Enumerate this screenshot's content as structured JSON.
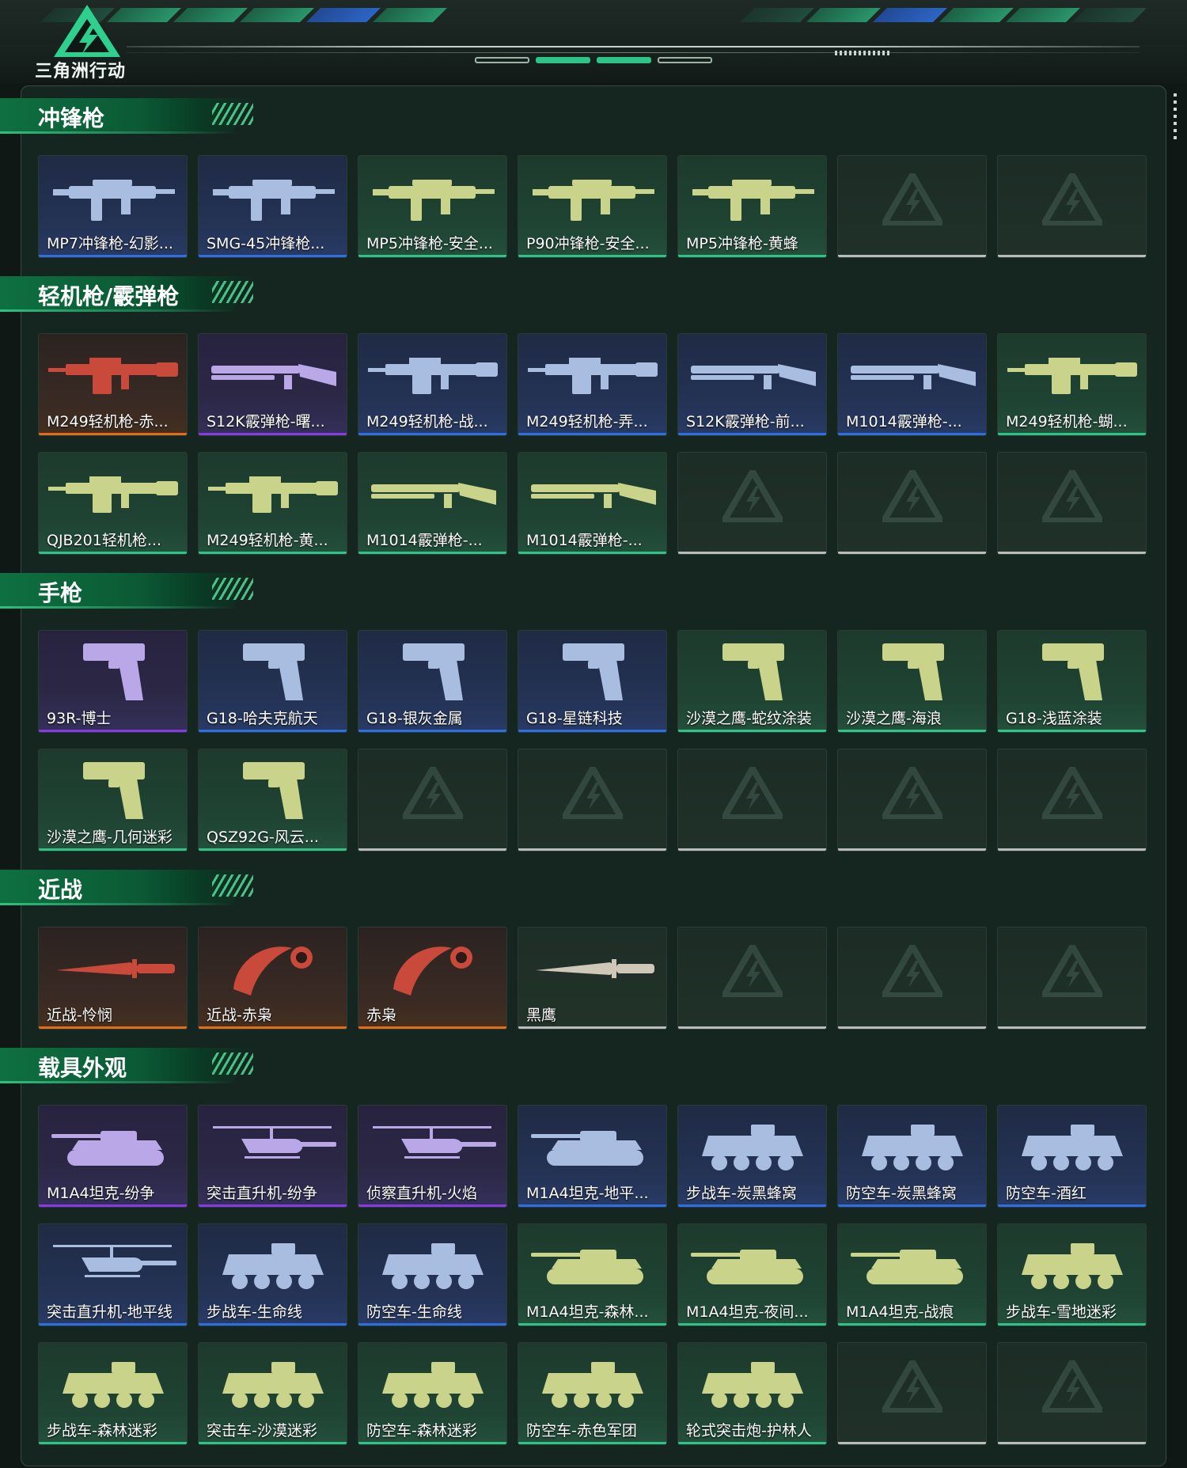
{
  "app": {
    "logo_text": "三角洲行动"
  },
  "colors": {
    "rarity_purple": "#8a39e6",
    "rarity_blue": "#2f6fe6",
    "rarity_green": "#2fc487",
    "rarity_orange": "#e56b16",
    "rarity_gray": "#b8bdbb",
    "accent": "#2ec17f"
  },
  "sections": [
    {
      "title": "冲锋枪",
      "items": [
        {
          "name": "MP7冲锋枪-幻影...",
          "rarity": "blue",
          "icon": "smg-icon"
        },
        {
          "name": "SMG-45冲锋枪...",
          "rarity": "blue",
          "icon": "smg-icon"
        },
        {
          "name": "MP5冲锋枪-安全...",
          "rarity": "green",
          "icon": "smg-icon"
        },
        {
          "name": "P90冲锋枪-安全...",
          "rarity": "green",
          "icon": "smg-icon"
        },
        {
          "name": "MP5冲锋枪-黄蜂",
          "rarity": "green",
          "icon": "smg-icon"
        },
        {
          "name": "",
          "rarity": "empty",
          "icon": "empty-slot-icon"
        },
        {
          "name": "",
          "rarity": "empty",
          "icon": "empty-slot-icon"
        }
      ]
    },
    {
      "title": "轻机枪/霰弹枪",
      "items": [
        {
          "name": "M249轻机枪-赤...",
          "rarity": "orange",
          "icon": "lmg-icon"
        },
        {
          "name": "S12K霰弹枪-曙...",
          "rarity": "purple",
          "icon": "shotgun-icon"
        },
        {
          "name": "M249轻机枪-战...",
          "rarity": "blue",
          "icon": "lmg-icon"
        },
        {
          "name": "M249轻机枪-弄...",
          "rarity": "blue",
          "icon": "lmg-icon"
        },
        {
          "name": "S12K霰弹枪-前...",
          "rarity": "blue",
          "icon": "shotgun-icon"
        },
        {
          "name": "M1014霰弹枪-...",
          "rarity": "blue",
          "icon": "shotgun-icon"
        },
        {
          "name": "M249轻机枪-蝴...",
          "rarity": "green",
          "icon": "lmg-icon"
        },
        {
          "name": "QJB201轻机枪...",
          "rarity": "green",
          "icon": "lmg-icon"
        },
        {
          "name": "M249轻机枪-黄...",
          "rarity": "green",
          "icon": "lmg-icon"
        },
        {
          "name": "M1014霰弹枪-...",
          "rarity": "green",
          "icon": "shotgun-icon"
        },
        {
          "name": "M1014霰弹枪-...",
          "rarity": "green",
          "icon": "shotgun-icon"
        },
        {
          "name": "",
          "rarity": "empty",
          "icon": "empty-slot-icon"
        },
        {
          "name": "",
          "rarity": "empty",
          "icon": "empty-slot-icon"
        },
        {
          "name": "",
          "rarity": "empty",
          "icon": "empty-slot-icon"
        }
      ]
    },
    {
      "title": "手枪",
      "items": [
        {
          "name": "93R-博士",
          "rarity": "purple",
          "icon": "pistol-icon"
        },
        {
          "name": "G18-哈夫克航天",
          "rarity": "blue",
          "icon": "pistol-icon"
        },
        {
          "name": "G18-银灰金属",
          "rarity": "blue",
          "icon": "pistol-icon"
        },
        {
          "name": "G18-星链科技",
          "rarity": "blue",
          "icon": "pistol-icon"
        },
        {
          "name": "沙漠之鹰-蛇纹涂装",
          "rarity": "green",
          "icon": "pistol-icon"
        },
        {
          "name": "沙漠之鹰-海浪",
          "rarity": "green",
          "icon": "pistol-icon"
        },
        {
          "name": "G18-浅蓝涂装",
          "rarity": "green",
          "icon": "pistol-icon"
        },
        {
          "name": "沙漠之鹰-几何迷彩",
          "rarity": "green",
          "icon": "pistol-icon"
        },
        {
          "name": "QSZ92G-风云...",
          "rarity": "green",
          "icon": "pistol-icon"
        },
        {
          "name": "",
          "rarity": "empty",
          "icon": "empty-slot-icon"
        },
        {
          "name": "",
          "rarity": "empty",
          "icon": "empty-slot-icon"
        },
        {
          "name": "",
          "rarity": "empty",
          "icon": "empty-slot-icon"
        },
        {
          "name": "",
          "rarity": "empty",
          "icon": "empty-slot-icon"
        },
        {
          "name": "",
          "rarity": "empty",
          "icon": "empty-slot-icon"
        }
      ]
    },
    {
      "title": "近战",
      "items": [
        {
          "name": "近战-怜悯",
          "rarity": "orange",
          "icon": "knife-icon"
        },
        {
          "name": "近战-赤枭",
          "rarity": "orange",
          "icon": "karambit-icon"
        },
        {
          "name": "赤枭",
          "rarity": "orange",
          "icon": "karambit-icon"
        },
        {
          "name": "黑鹰",
          "rarity": "gray",
          "icon": "knife-icon"
        },
        {
          "name": "",
          "rarity": "empty",
          "icon": "empty-slot-icon"
        },
        {
          "name": "",
          "rarity": "empty",
          "icon": "empty-slot-icon"
        },
        {
          "name": "",
          "rarity": "empty",
          "icon": "empty-slot-icon"
        }
      ]
    },
    {
      "title": "载具外观",
      "items": [
        {
          "name": "M1A4坦克-纷争",
          "rarity": "purple",
          "icon": "tank-icon"
        },
        {
          "name": "突击直升机-纷争",
          "rarity": "purple",
          "icon": "helicopter-icon"
        },
        {
          "name": "侦察直升机-火焰",
          "rarity": "purple",
          "icon": "helicopter-icon"
        },
        {
          "name": "M1A4坦克-地平...",
          "rarity": "blue",
          "icon": "tank-icon"
        },
        {
          "name": "步战车-炭黑蜂窝",
          "rarity": "blue",
          "icon": "apc-icon"
        },
        {
          "name": "防空车-炭黑蜂窝",
          "rarity": "blue",
          "icon": "apc-icon"
        },
        {
          "name": "防空车-酒红",
          "rarity": "blue",
          "icon": "apc-icon"
        },
        {
          "name": "突击直升机-地平线",
          "rarity": "blue",
          "icon": "helicopter-icon"
        },
        {
          "name": "步战车-生命线",
          "rarity": "blue",
          "icon": "apc-icon"
        },
        {
          "name": "防空车-生命线",
          "rarity": "blue",
          "icon": "apc-icon"
        },
        {
          "name": "M1A4坦克-森林...",
          "rarity": "green",
          "icon": "tank-icon"
        },
        {
          "name": "M1A4坦克-夜间...",
          "rarity": "green",
          "icon": "tank-icon"
        },
        {
          "name": "M1A4坦克-战痕",
          "rarity": "green",
          "icon": "tank-icon"
        },
        {
          "name": "步战车-雪地迷彩",
          "rarity": "green",
          "icon": "apc-icon"
        },
        {
          "name": "步战车-森林迷彩",
          "rarity": "green",
          "icon": "apc-icon"
        },
        {
          "name": "突击车-沙漠迷彩",
          "rarity": "green",
          "icon": "apc-icon"
        },
        {
          "name": "防空车-森林迷彩",
          "rarity": "green",
          "icon": "apc-icon"
        },
        {
          "name": "防空车-赤色军团",
          "rarity": "green",
          "icon": "apc-icon"
        },
        {
          "name": "轮式突击炮-护林人",
          "rarity": "green",
          "icon": "apc-icon"
        },
        {
          "name": "",
          "rarity": "empty",
          "icon": "empty-slot-icon"
        },
        {
          "name": "",
          "rarity": "empty",
          "icon": "empty-slot-icon"
        }
      ]
    }
  ]
}
